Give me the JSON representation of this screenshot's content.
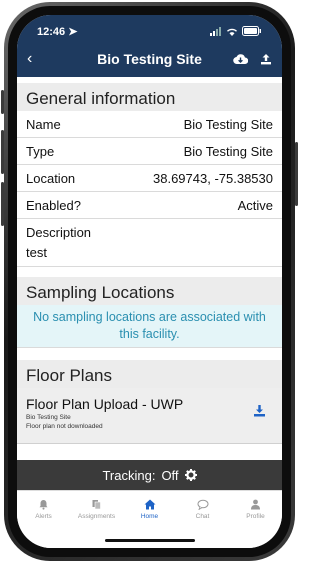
{
  "status_bar": {
    "time": "12:46"
  },
  "nav": {
    "title": "Bio Testing Site"
  },
  "general": {
    "heading": "General information",
    "rows": [
      {
        "label": "Name",
        "value": "Bio Testing Site"
      },
      {
        "label": "Type",
        "value": "Bio Testing Site"
      },
      {
        "label": "Location",
        "value": "38.69743, -75.38530"
      },
      {
        "label": "Enabled?",
        "value": "Active"
      }
    ],
    "description_label": "Description",
    "description_value": "test"
  },
  "sampling": {
    "heading": "Sampling Locations",
    "notice": "No sampling locations are associated with this facility."
  },
  "floor_plans": {
    "heading": "Floor Plans",
    "items": [
      {
        "title": "Floor Plan Upload - UWP",
        "site": "Bio Testing Site",
        "status": "Floor plan not downloaded"
      }
    ]
  },
  "tracking": {
    "label": "Tracking:",
    "value": "Off"
  },
  "tabs": [
    {
      "label": "Alerts",
      "icon": "bell-icon"
    },
    {
      "label": "Assignments",
      "icon": "files-icon"
    },
    {
      "label": "Home",
      "icon": "home-icon"
    },
    {
      "label": "Chat",
      "icon": "chat-icon"
    },
    {
      "label": "Profile",
      "icon": "user-icon"
    }
  ],
  "colors": {
    "header": "#1e3a5f",
    "accent": "#1e63c6",
    "notice_text": "#2a8fb0"
  }
}
